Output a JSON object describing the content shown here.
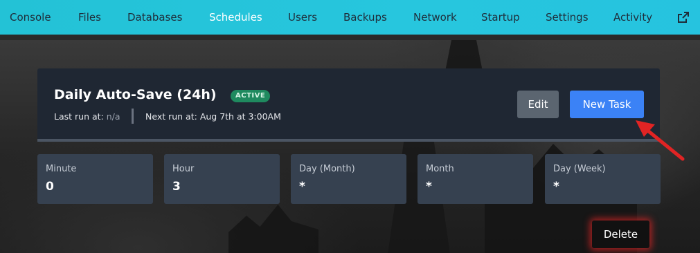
{
  "nav": {
    "items": [
      {
        "label": "Console",
        "active": false
      },
      {
        "label": "Files",
        "active": false
      },
      {
        "label": "Databases",
        "active": false
      },
      {
        "label": "Schedules",
        "active": true
      },
      {
        "label": "Users",
        "active": false
      },
      {
        "label": "Backups",
        "active": false
      },
      {
        "label": "Network",
        "active": false
      },
      {
        "label": "Startup",
        "active": false
      },
      {
        "label": "Settings",
        "active": false
      },
      {
        "label": "Activity",
        "active": false
      }
    ],
    "external_icon": "external-link-icon"
  },
  "schedule": {
    "title": "Daily Auto-Save (24h)",
    "status": "ACTIVE",
    "last_run_label": "Last run at:",
    "last_run_value": "n/a",
    "next_run_label": "Next run at:",
    "next_run_value": "Aug 7th at 3:00AM",
    "edit_label": "Edit",
    "new_task_label": "New Task",
    "delete_label": "Delete"
  },
  "cron": [
    {
      "label": "Minute",
      "value": "0"
    },
    {
      "label": "Hour",
      "value": "3"
    },
    {
      "label": "Day (Month)",
      "value": "*"
    },
    {
      "label": "Month",
      "value": "*"
    },
    {
      "label": "Day (Week)",
      "value": "*"
    }
  ],
  "colors": {
    "navbar": "#26c3df",
    "card": "#1f2733",
    "badge": "#1f8a5f",
    "new_task": "#3b82f6",
    "annotation_arrow": "#e02424"
  }
}
